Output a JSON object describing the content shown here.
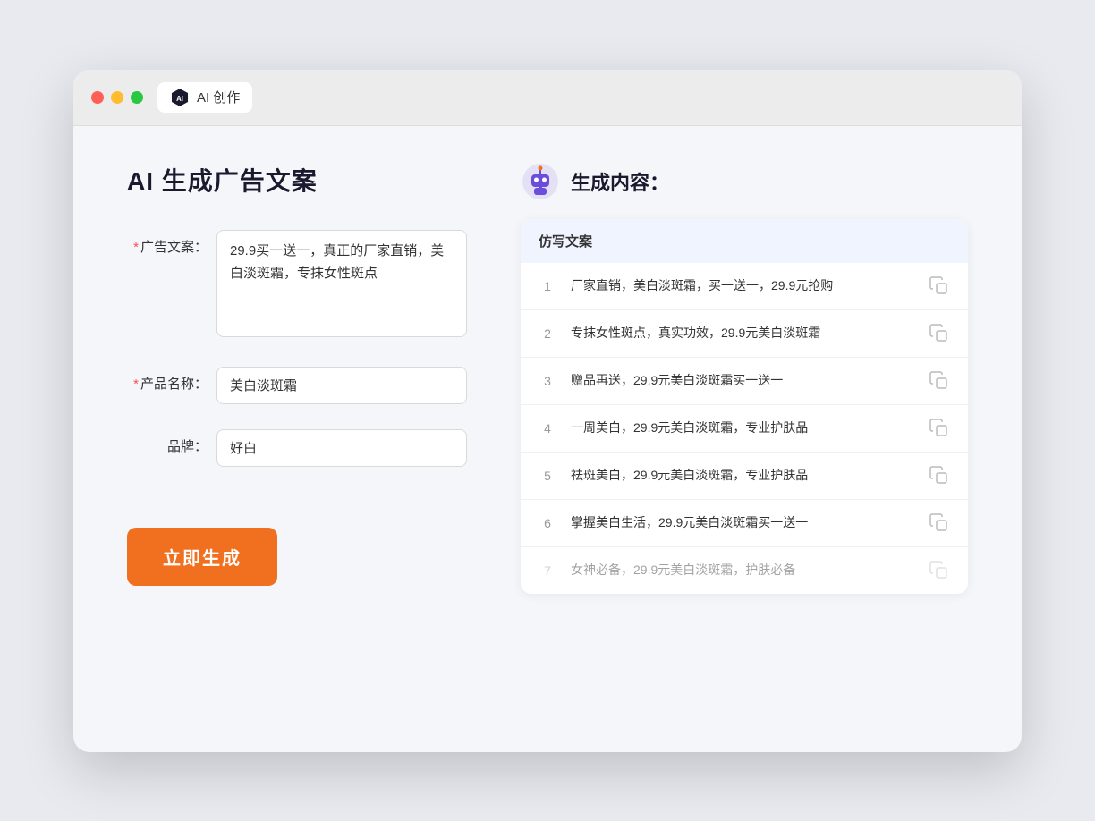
{
  "browser": {
    "tab_label": "AI 创作",
    "traffic_lights": [
      "red",
      "yellow",
      "green"
    ]
  },
  "page": {
    "title": "AI 生成广告文案",
    "form": {
      "ad_copy_label": "广告文案：",
      "ad_copy_required": "*",
      "ad_copy_value": "29.9买一送一，真正的厂家直销，美白淡斑霜，专抹女性斑点",
      "product_name_label": "产品名称：",
      "product_name_required": "*",
      "product_name_value": "美白淡斑霜",
      "brand_label": "品牌：",
      "brand_value": "好白",
      "generate_btn": "立即生成"
    },
    "result": {
      "header": "生成内容：",
      "column_label": "仿写文案",
      "rows": [
        {
          "num": "1",
          "text": "厂家直销，美白淡斑霜，买一送一，29.9元抢购",
          "dimmed": false
        },
        {
          "num": "2",
          "text": "专抹女性斑点，真实功效，29.9元美白淡斑霜",
          "dimmed": false
        },
        {
          "num": "3",
          "text": "赠品再送，29.9元美白淡斑霜买一送一",
          "dimmed": false
        },
        {
          "num": "4",
          "text": "一周美白，29.9元美白淡斑霜，专业护肤品",
          "dimmed": false
        },
        {
          "num": "5",
          "text": "祛斑美白，29.9元美白淡斑霜，专业护肤品",
          "dimmed": false
        },
        {
          "num": "6",
          "text": "掌握美白生活，29.9元美白淡斑霜买一送一",
          "dimmed": false
        },
        {
          "num": "7",
          "text": "女神必备，29.9元美白淡斑霜，护肤必备",
          "dimmed": true
        }
      ]
    }
  }
}
